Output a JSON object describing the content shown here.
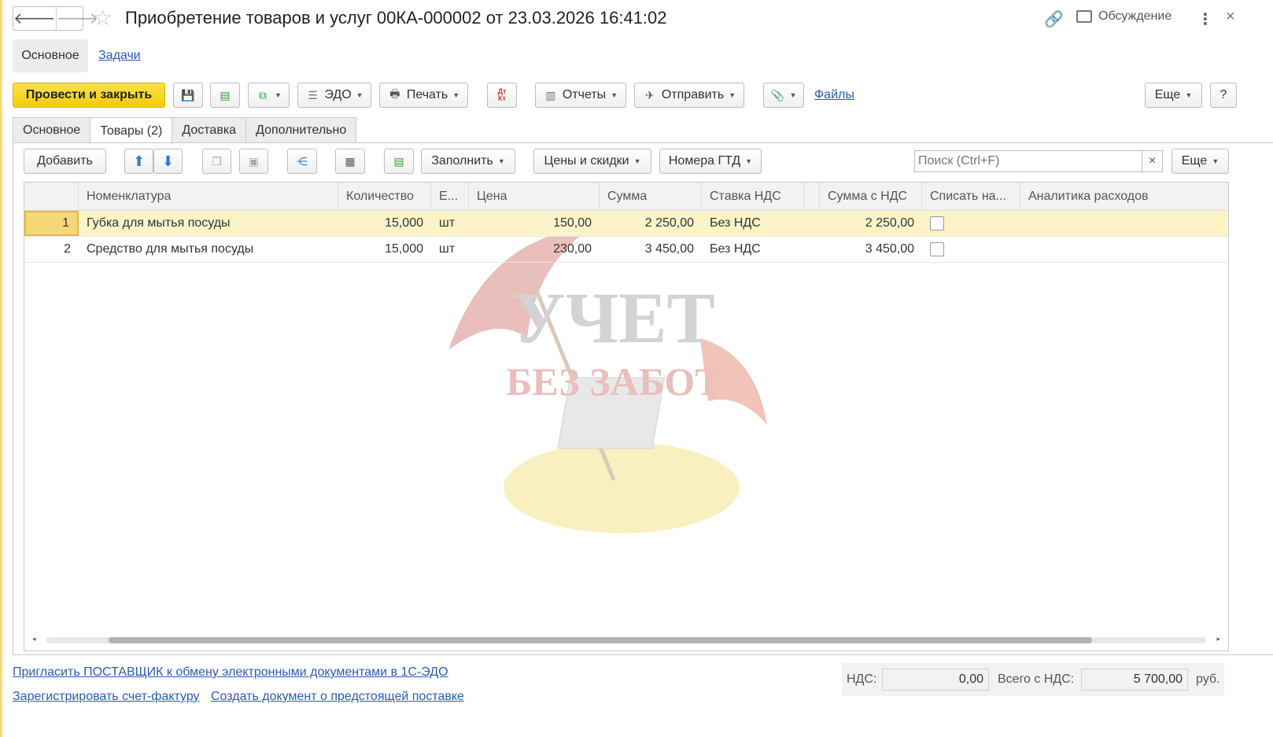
{
  "window": {
    "title": "Приобретение товаров и услуг 00КА-000002 от 23.03.2026 16:41:02",
    "discussion_label": "Обсуждение"
  },
  "subnav": {
    "main_label": "Основное",
    "tasks_label": "Задачи"
  },
  "toolbar": {
    "post_close_label": "Провести и закрыть",
    "edo_label": "ЭДО",
    "print_label": "Печать",
    "reports_label": "Отчеты",
    "send_label": "Отправить",
    "files_label": "Файлы",
    "more_label": "Еще",
    "help_label": "?",
    "dtkt_label": "Дт Кт"
  },
  "tabs": [
    {
      "label": "Основное"
    },
    {
      "label": "Товары (2)"
    },
    {
      "label": "Доставка"
    },
    {
      "label": "Дополнительно"
    }
  ],
  "goods_toolbar": {
    "add_label": "Добавить",
    "fill_label": "Заполнить",
    "prices_label": "Цены и скидки",
    "gtd_label": "Номера ГТД",
    "search_placeholder": "Поиск (Ctrl+F)",
    "more_label": "Еще"
  },
  "table": {
    "columns": [
      "Номенклатура",
      "Количество",
      "Е...",
      "Цена",
      "Сумма",
      "Ставка НДС",
      "Сумма с НДС",
      "Списать на...",
      "Аналитика расходов"
    ],
    "rows": [
      {
        "n": "1",
        "item": "Губка для мытья посуды",
        "qty": "15,000",
        "unit": "шт",
        "price": "150,00",
        "sum": "2 250,00",
        "vat_rate": "Без НДС",
        "sum_vat": "2 250,00"
      },
      {
        "n": "2",
        "item": "Средство для мытья посуды",
        "qty": "15,000",
        "unit": "шт",
        "price": "230,00",
        "sum": "3 450,00",
        "vat_rate": "Без НДС",
        "sum_vat": "3 450,00"
      }
    ]
  },
  "watermark": {
    "line1": "УЧЕТ",
    "line2": "БЕЗ ЗАБОТ"
  },
  "footer": {
    "invite_link": "Пригласить ПОСТАВЩИК к обмену электронными документами в 1С-ЭДО",
    "register_invoice_link": "Зарегистрировать счет-фактуру",
    "create_doc_link": "Создать документ о предстоящей поставке",
    "vat_label": "НДС:",
    "vat_value": "0,00",
    "total_label": "Всего с НДС:",
    "total_value": "5 700,00",
    "currency": "руб."
  }
}
